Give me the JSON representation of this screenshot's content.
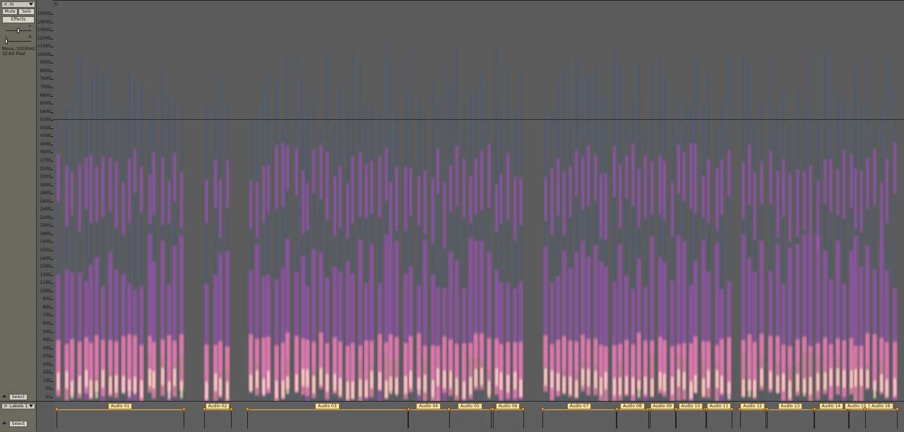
{
  "track": {
    "name": "hi",
    "mute_label": "Mute",
    "solo_label": "Solo",
    "effects_label": "Effects",
    "gain_min": "-",
    "gain_max": "+",
    "pan_left": "L",
    "pan_right": "R",
    "info_line1": "Mono, 32000Hz",
    "info_line2": "32-bit float",
    "select_label": "Select",
    "clip_name": "hi"
  },
  "ruler": {
    "labels": [
      "15000",
      "14000",
      "13000",
      "12000",
      "11000",
      "10000",
      "9000",
      "8000",
      "7600",
      "7000",
      "6600",
      "6000",
      "5600",
      "5200",
      "5000",
      "4700",
      "4400",
      "4000",
      "3700",
      "3500",
      "3300",
      "3000",
      "2800",
      "2600",
      "2400",
      "2200",
      "2000",
      "1800",
      "1600",
      "1500",
      "1400",
      "1300",
      "1200",
      "1100",
      "1000",
      "900",
      "800",
      "700",
      "600",
      "500",
      "400",
      "300",
      "250",
      "200",
      "150",
      "100",
      "50",
      "10"
    ]
  },
  "label_track": {
    "name": "Labels 1",
    "select_label": "Select",
    "labels": [
      {
        "text": "Audio 01",
        "start": 0.0,
        "end": 0.151
      },
      {
        "text": "Audio 02",
        "start": 0.175,
        "end": 0.207
      },
      {
        "text": "Audio 03",
        "start": 0.226,
        "end": 0.416
      },
      {
        "text": "Audio 04",
        "start": 0.417,
        "end": 0.465
      },
      {
        "text": "Audio 05",
        "start": 0.465,
        "end": 0.515
      },
      {
        "text": "Audio 06",
        "start": 0.517,
        "end": 0.553
      },
      {
        "text": "Audio 07",
        "start": 0.576,
        "end": 0.663
      },
      {
        "text": "Audio 08",
        "start": 0.664,
        "end": 0.701
      },
      {
        "text": "Audio 09",
        "start": 0.703,
        "end": 0.733
      },
      {
        "text": "Audio 10",
        "start": 0.734,
        "end": 0.769
      },
      {
        "text": "Audio 11",
        "start": 0.77,
        "end": 0.8
      },
      {
        "text": "Audio 12",
        "start": 0.81,
        "end": 0.84
      },
      {
        "text": "Audio 13",
        "start": 0.842,
        "end": 0.897
      },
      {
        "text": "Audio 14",
        "start": 0.898,
        "end": 0.938
      },
      {
        "text": "Audio 15",
        "start": 0.939,
        "end": 0.958
      },
      {
        "text": "Audio 16",
        "start": 0.958,
        "end": 0.996
      }
    ]
  },
  "colors": {
    "spectrogram_background": "#5c5c5c",
    "low_energy": "#3d5a8a",
    "mid_energy": "#b050c8",
    "high_energy": "#ff8ab0",
    "peak_energy": "#fff2c8",
    "label_fill": "#f7e2a8",
    "label_line": "#e8b24a"
  }
}
